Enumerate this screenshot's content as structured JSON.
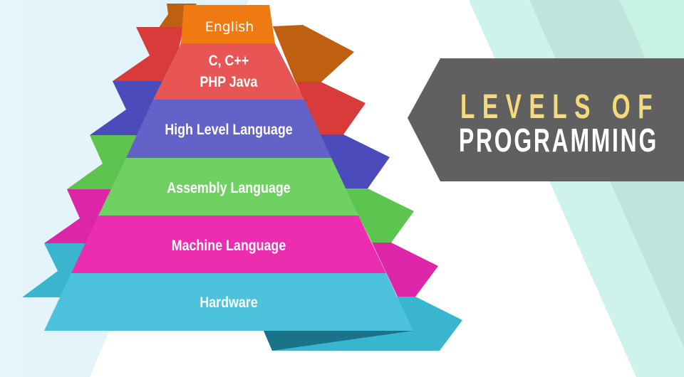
{
  "title": {
    "line1": "LEVELS OF",
    "line2": "PROGRAMMING"
  },
  "pyramid": {
    "tiers": [
      {
        "label": "English"
      },
      {
        "label_line1": "C, C++",
        "label_line2": "PHP Java"
      },
      {
        "label": "High Level Language"
      },
      {
        "label": "Assembly Language"
      },
      {
        "label": "Machine Language"
      },
      {
        "label": "Hardware"
      }
    ]
  },
  "colors": {
    "banner": "#606060",
    "title_line1": "#f4da7a",
    "title_line2": "#ffffff",
    "english": "#ef7a12",
    "c_php": "#e85555",
    "high_level": "#6262c8",
    "assembly": "#6fd162",
    "machine": "#ec2db0",
    "hardware": "#4cc2dc"
  }
}
